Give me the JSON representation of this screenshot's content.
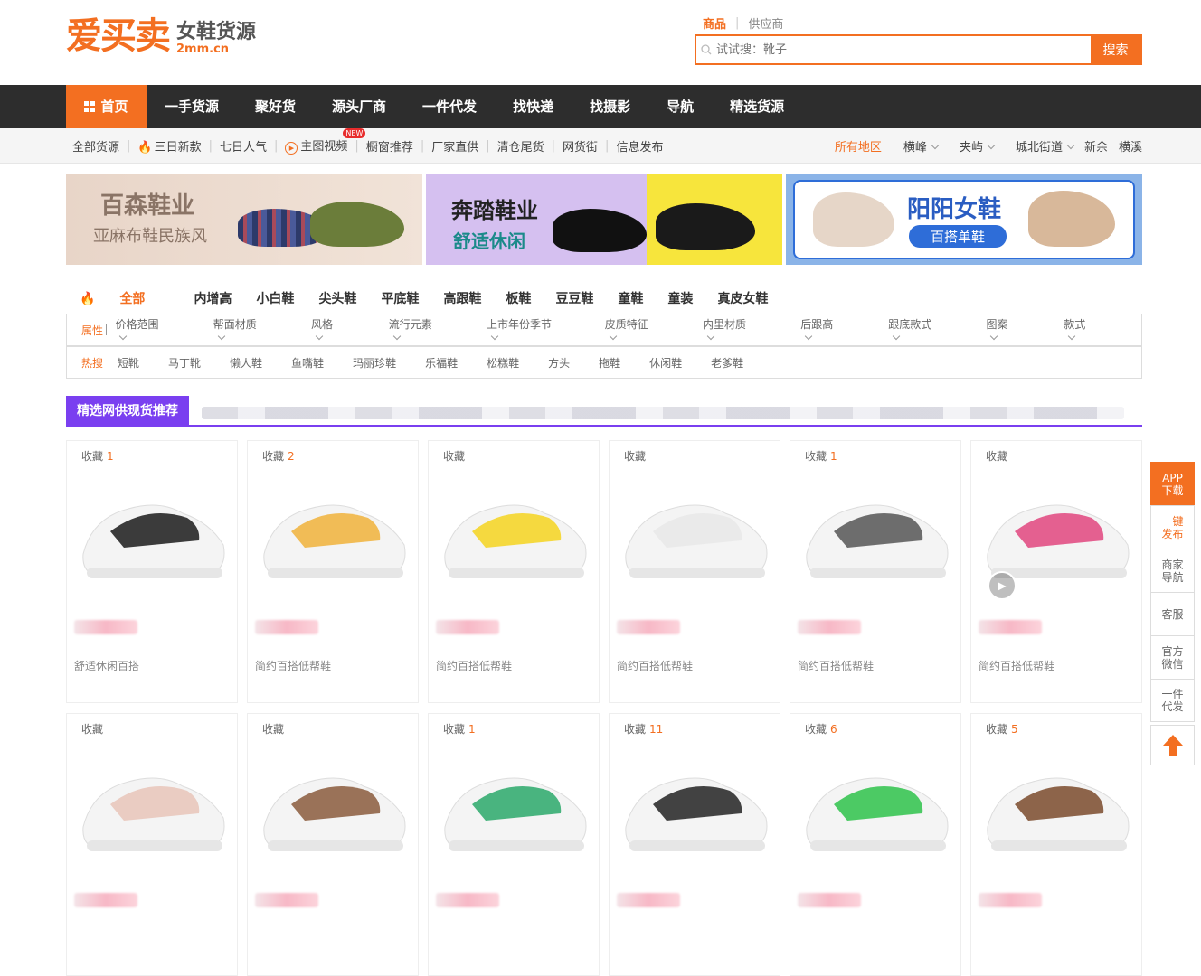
{
  "header": {
    "logo_main": "爱买卖",
    "logo_sub": "女鞋货源",
    "logo_domain": "2mm.cn",
    "search_tabs": [
      "商品",
      "供应商"
    ],
    "search_placeholder": "试试搜：靴子",
    "search_button": "搜索"
  },
  "main_nav": [
    "首页",
    "一手货源",
    "聚好货",
    "源头厂商",
    "一件代发",
    "找快递",
    "找摄影",
    "导航",
    "精选货源"
  ],
  "sub_nav": {
    "left": [
      "全部货源",
      "三日新款",
      "七日人气",
      "主图视频",
      "橱窗推荐",
      "厂家直供",
      "清仓尾货",
      "网货街",
      "信息发布"
    ],
    "new_badge": "NEW",
    "regions": [
      "所有地区",
      "横峰",
      "夹屿",
      "城北街道",
      "新余",
      "横溪"
    ]
  },
  "banners": [
    {
      "title": "百森鞋业",
      "subtitle": "亚麻布鞋民族风"
    },
    {
      "title": "奔踏鞋业",
      "subtitle": "舒适休闲"
    },
    {
      "title": "阳阳女鞋",
      "subtitle": "百搭单鞋"
    }
  ],
  "categories": [
    "全部",
    "内增高",
    "小白鞋",
    "尖头鞋",
    "平底鞋",
    "高跟鞋",
    "板鞋",
    "豆豆鞋",
    "童鞋",
    "童装",
    "真皮女鞋"
  ],
  "filters": {
    "attr_label": "属性",
    "attrs": [
      "价格范围",
      "帮面材质",
      "风格",
      "流行元素",
      "上市年份季节",
      "皮质特征",
      "内里材质",
      "后跟高",
      "跟底款式",
      "图案",
      "款式"
    ],
    "hot_label": "热搜",
    "hot": [
      "短靴",
      "马丁靴",
      "懒人鞋",
      "鱼嘴鞋",
      "玛丽珍鞋",
      "乐福鞋",
      "松糕鞋",
      "方头",
      "拖鞋",
      "休闲鞋",
      "老爹鞋"
    ]
  },
  "section_title": "精选网供现货推荐",
  "fav_label": "收藏",
  "products": [
    {
      "fav": "1",
      "title": "舒适休闲百搭",
      "color": "#1a1a1a"
    },
    {
      "fav": "2",
      "title": "简约百搭低帮鞋",
      "color": "#f0b23a"
    },
    {
      "fav": "",
      "title": "简约百搭低帮鞋",
      "color": "#f5d31e"
    },
    {
      "fav": "",
      "title": "简约百搭低帮鞋",
      "color": "#e8e8e8"
    },
    {
      "fav": "1",
      "title": "简约百搭低帮鞋",
      "color": "#555555"
    },
    {
      "fav": "",
      "title": "简约百搭低帮鞋",
      "color": "#e0457e"
    },
    {
      "fav": "",
      "title": "",
      "color": "#e8c4b8"
    },
    {
      "fav": "",
      "title": "",
      "color": "#8a5a3c"
    },
    {
      "fav": "1",
      "title": "",
      "color": "#2aa86a"
    },
    {
      "fav": "11",
      "title": "",
      "color": "#222222"
    },
    {
      "fav": "6",
      "title": "",
      "color": "#2ec24a"
    },
    {
      "fav": "5",
      "title": "",
      "color": "#7a4a2c"
    }
  ],
  "side_tools": [
    "APP\n下载",
    "一键\n发布",
    "商家\n导航",
    "客服",
    "官方\n微信",
    "一件\n代发"
  ]
}
